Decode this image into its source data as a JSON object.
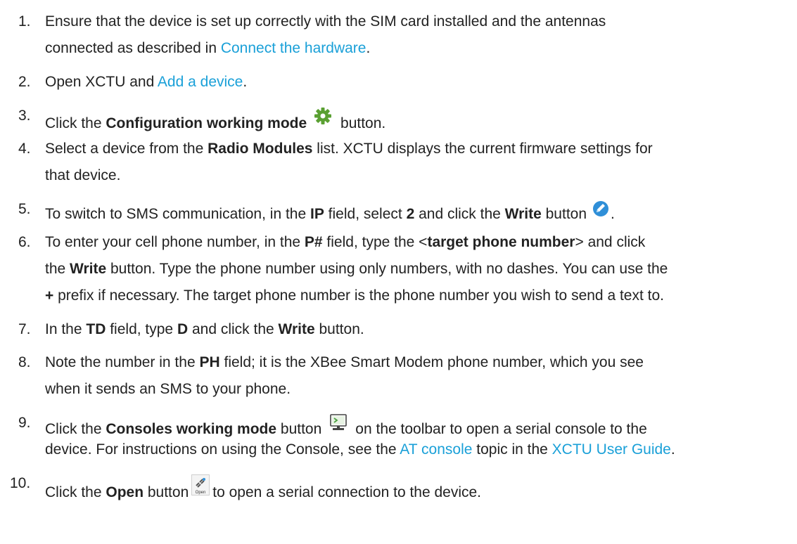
{
  "steps": [
    {
      "number": "1.",
      "lines": [
        [
          "Ensure that the device is set up correctly with the SIM card installed and the antennas"
        ],
        [
          "connected as described in ",
          {
            "link": "Connect the hardware"
          },
          "."
        ]
      ]
    },
    {
      "number": "2.",
      "lines": [
        [
          "Open XCTU and ",
          {
            "link": "Add a device"
          },
          "."
        ]
      ]
    },
    {
      "number": "3.",
      "lines": [
        [
          "Click the ",
          {
            "b": "Configuration working mode"
          },
          {
            "icon": "gear-icon"
          },
          " button."
        ]
      ]
    },
    {
      "number": "4.",
      "lines": [
        [
          "Select a device from the ",
          {
            "b": "Radio Modules"
          },
          " list. XCTU displays the current firmware settings for"
        ],
        [
          "that device."
        ]
      ]
    },
    {
      "number": "5.",
      "lines": [
        [
          "To switch to SMS communication, in the ",
          {
            "b": "IP"
          },
          " field, select ",
          {
            "b": "2"
          },
          " and click the ",
          {
            "b": "Write"
          },
          " button",
          {
            "icon": "write-pencil-icon"
          },
          "."
        ]
      ]
    },
    {
      "number": "6.",
      "lines": [
        [
          "To enter your cell phone number, in the ",
          {
            "b": "P#"
          },
          " field, type the <",
          {
            "b": "target phone number"
          },
          "> and click"
        ],
        [
          "the ",
          {
            "b": "Write"
          },
          " button. Type the phone number using only numbers, with no dashes. You can use the"
        ],
        [
          {
            "b": "+"
          },
          " prefix if necessary. The target phone number is the phone number you wish to send a text to."
        ]
      ]
    },
    {
      "number": "7.",
      "lines": [
        [
          "In the ",
          {
            "b": "TD"
          },
          " field, type ",
          {
            "b": "D"
          },
          " and click the ",
          {
            "b": "Write"
          },
          " button."
        ]
      ]
    },
    {
      "number": "8.",
      "lines": [
        [
          "Note the number in the ",
          {
            "b": "PH"
          },
          " field; it is the XBee Smart Modem phone number, which you see"
        ],
        [
          "when it sends an SMS to your phone."
        ]
      ]
    },
    {
      "number": "9.",
      "lines": [
        [
          "Click the ",
          {
            "b": "Consoles working mode"
          },
          " button",
          {
            "icon": "console-monitor-icon"
          },
          "on the toolbar to open a serial console to the"
        ],
        [
          "device. For instructions on using the Console, see the ",
          {
            "link": "AT console"
          },
          " topic in the ",
          {
            "link": "XCTU User Guide"
          },
          "."
        ]
      ]
    },
    {
      "number": "10.",
      "lines": [
        [
          "Click the ",
          {
            "b": "Open"
          },
          " button",
          {
            "icon": "open-connection-icon",
            "label": "Open"
          },
          "to open a serial connection to the device."
        ]
      ]
    }
  ],
  "colors": {
    "text": "#222222",
    "link": "#1aa0d8",
    "gear": "#5aa032",
    "write_icon": "#2f8fd8",
    "console_icon": "#4aa040"
  }
}
